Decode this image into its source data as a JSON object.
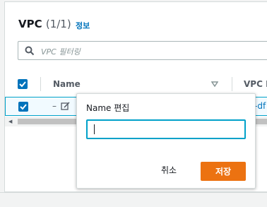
{
  "header": {
    "title": "VPC",
    "count": "(1/1)",
    "info_link": "정보"
  },
  "search": {
    "placeholder": "VPC 필터링"
  },
  "table": {
    "columns": [
      "Name",
      "VPC II"
    ],
    "rows": [
      {
        "selected": true,
        "name": "–",
        "vpc_id_partial": "-df"
      }
    ]
  },
  "popover": {
    "label": "Name 편집",
    "input_value": "",
    "cancel_label": "취소",
    "save_label": "저장"
  },
  "colors": {
    "accent_blue": "#0073bb",
    "focus_cyan": "#00a1c9",
    "primary_orange": "#ec7211",
    "selected_row_bg": "#f1faff"
  },
  "icons": [
    "search-icon",
    "edit-icon",
    "sort-down-icon",
    "checkbox-checked-icon"
  ]
}
